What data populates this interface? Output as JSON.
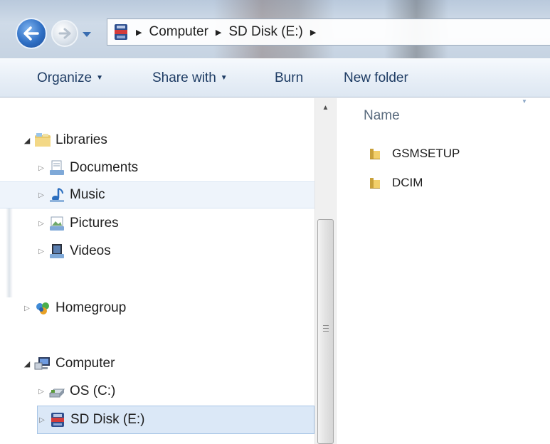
{
  "address_bar": {
    "crumbs": [
      "Computer",
      "SD Disk (E:)"
    ]
  },
  "toolbar": {
    "organize": "Organize",
    "share_with": "Share with",
    "burn": "Burn",
    "new_folder": "New folder"
  },
  "nav_pane": {
    "libraries": {
      "label": "Libraries",
      "items": [
        {
          "label": "Documents",
          "icon": "documents-library-icon"
        },
        {
          "label": "Music",
          "icon": "music-library-icon"
        },
        {
          "label": "Pictures",
          "icon": "pictures-library-icon"
        },
        {
          "label": "Videos",
          "icon": "videos-library-icon"
        }
      ]
    },
    "homegroup": {
      "label": "Homegroup"
    },
    "computer": {
      "label": "Computer",
      "items": [
        {
          "label": "OS (C:)",
          "icon": "hard-drive-icon"
        },
        {
          "label": "SD Disk (E:)",
          "icon": "sd-card-icon"
        }
      ]
    }
  },
  "content": {
    "column_header": "Name",
    "files": [
      {
        "name": "GSMSETUP",
        "icon": "folder-icon"
      },
      {
        "name": "DCIM",
        "icon": "folder-icon"
      }
    ]
  },
  "colors": {
    "toolbar_text": "#1e3c64",
    "selection": "#dbe8f7",
    "hover": "#eef4fb",
    "header_text": "#5a6b7e"
  }
}
